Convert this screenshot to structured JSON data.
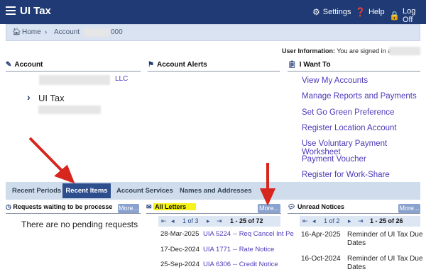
{
  "header": {
    "brand": "UI Tax",
    "settings": "Settings",
    "help": "Help",
    "logoff": "Log Off"
  },
  "breadcrumb": {
    "home": "Home",
    "account_label": "Account",
    "account_suffix": "000"
  },
  "user_info": {
    "label": "User Information:",
    "text": "You are signed in a"
  },
  "panels": {
    "account": {
      "title": "Account",
      "company_suffix": "LLC",
      "program": "UI Tax"
    },
    "alerts": {
      "title": "Account Alerts"
    },
    "i_want_to": {
      "title": "I Want To",
      "items": [
        "View My Accounts",
        "Manage Reports and Payments",
        "Set Go Green Preference",
        "Register Location Account",
        "Use Voluntary Payment Worksheet",
        "Payment Voucher",
        "Register for Work-Share"
      ]
    }
  },
  "tabs": [
    "Recent Periods",
    "Recent Items",
    "Account Services",
    "Names and Addresses"
  ],
  "active_tab": "Recent Items",
  "requests": {
    "title": "Requests waiting to be processe",
    "more": "More...",
    "empty": "There are no pending requests"
  },
  "letters": {
    "title": "All Letters",
    "more": "More...",
    "pager": "1 of 3",
    "range": "1 - 25 of 72",
    "rows": [
      {
        "date": "28-Mar-2025",
        "desc": "UIA 5224 -- Req Cancel Int Pe"
      },
      {
        "date": "17-Dec-2024",
        "desc": "UIA 1771 -- Rate Notice"
      },
      {
        "date": "25-Sep-2024",
        "desc": "UIA 6306 -- Credit Notice"
      }
    ]
  },
  "notices": {
    "title": "Unread Notices",
    "more": "More...",
    "pager": "1 of 2",
    "range": "1 - 25 of 26",
    "rows": [
      {
        "date": "16-Apr-2025",
        "line1": "Reminder of UI Tax Due",
        "line2": "Dates"
      },
      {
        "date": "16-Oct-2024",
        "line1": "Reminder of UI Tax Due",
        "line2": "Dates"
      }
    ]
  },
  "colors": {
    "topbar": "#1f3a74",
    "link": "#4e3ab9",
    "highlight": "#f6f31a",
    "annotation_arrow": "#d6261e"
  }
}
